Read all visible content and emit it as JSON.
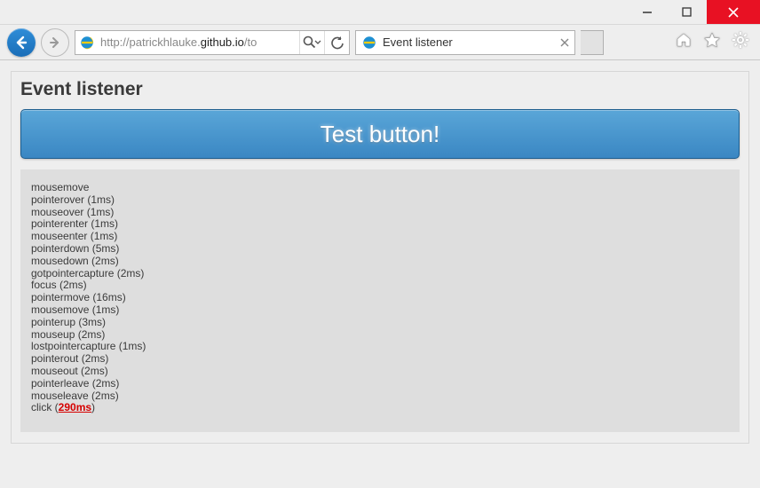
{
  "browser": {
    "url_prefix": "http://patrickhlauke.",
    "url_domain": "github.io",
    "url_suffix": "/to",
    "tab_title": "Event listener"
  },
  "page": {
    "heading": "Event listener",
    "button_label": "Test button!"
  },
  "events": [
    {
      "name": "mousemove",
      "time": null
    },
    {
      "name": "pointerover",
      "time": "1ms"
    },
    {
      "name": "mouseover",
      "time": "1ms"
    },
    {
      "name": "pointerenter",
      "time": "1ms"
    },
    {
      "name": "mouseenter",
      "time": "1ms"
    },
    {
      "name": "pointerdown",
      "time": "5ms"
    },
    {
      "name": "mousedown",
      "time": "2ms"
    },
    {
      "name": "gotpointercapture",
      "time": "2ms"
    },
    {
      "name": "focus",
      "time": "2ms"
    },
    {
      "name": "pointermove",
      "time": "16ms"
    },
    {
      "name": "mousemove",
      "time": "1ms"
    },
    {
      "name": "pointerup",
      "time": "3ms"
    },
    {
      "name": "mouseup",
      "time": "2ms"
    },
    {
      "name": "lostpointercapture",
      "time": "1ms"
    },
    {
      "name": "pointerout",
      "time": "2ms"
    },
    {
      "name": "mouseout",
      "time": "2ms"
    },
    {
      "name": "pointerleave",
      "time": "2ms"
    },
    {
      "name": "mouseleave",
      "time": "2ms"
    },
    {
      "name": "click",
      "time": "290ms",
      "highlight": true
    }
  ]
}
